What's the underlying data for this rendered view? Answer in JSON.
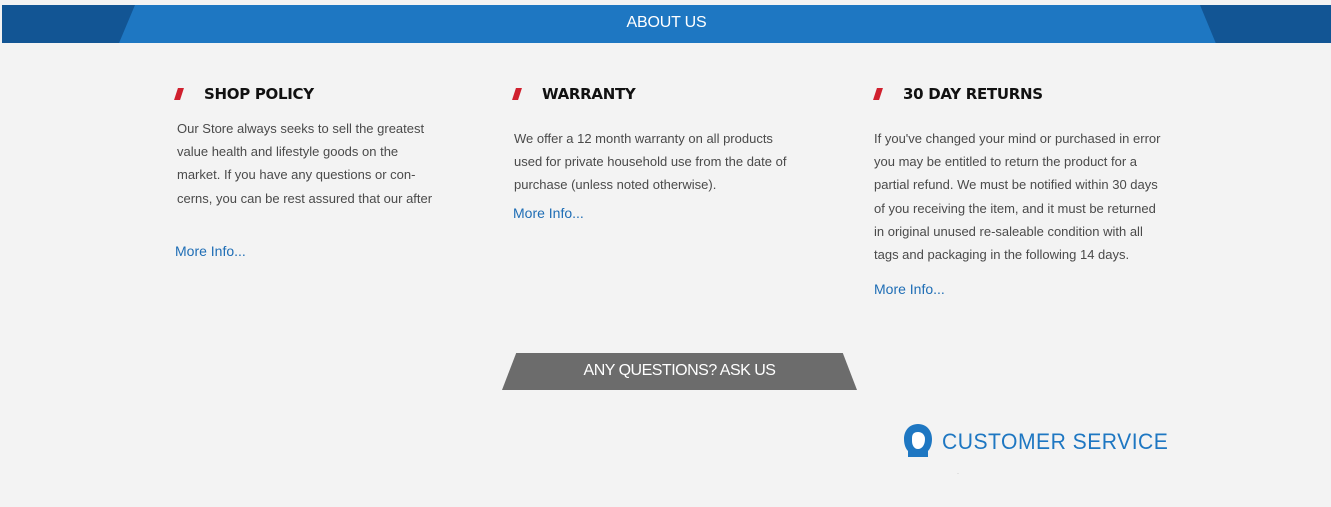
{
  "header": {
    "title": "ABOUT US"
  },
  "columns": [
    {
      "title": "SHOP POLICY",
      "lines": [
        "Our Store always seeks to sell the greatest",
        "value health and lifestyle goods on the",
        "market. If you have any questions or con-",
        "cerns, you can be rest assured that our after"
      ],
      "link": "More Info..."
    },
    {
      "title": "WARRANTY",
      "lines": [
        "We offer a 12 month warranty on all products",
        "used for private household use from the date of",
        "purchase (unless noted otherwise)."
      ],
      "link": "More Info..."
    },
    {
      "title": "30 DAY RETURNS",
      "lines": [
        "If you've changed your mind or purchased in error",
        "you may be entitled to return the product for a",
        "partial refund. We must be notified within 30 days",
        "of you receiving the item, and it must be returned",
        "in original unused re-saleable condition with all",
        "tags and packaging in the following 14 days."
      ],
      "link": "More Info..."
    }
  ],
  "ask_button": {
    "label": "ANY QUESTIONS? ASK US"
  },
  "customer_service": {
    "label": "CUSTOMER SERVICE",
    "icon": "headset-agent-icon"
  },
  "colors": {
    "banner_blue": "#1e77c2",
    "banner_dark": "#125594",
    "accent_red": "#d0202e",
    "link_blue": "#1e6db5",
    "button_gray": "#6c6c6c",
    "background": "#f3f3f3"
  }
}
